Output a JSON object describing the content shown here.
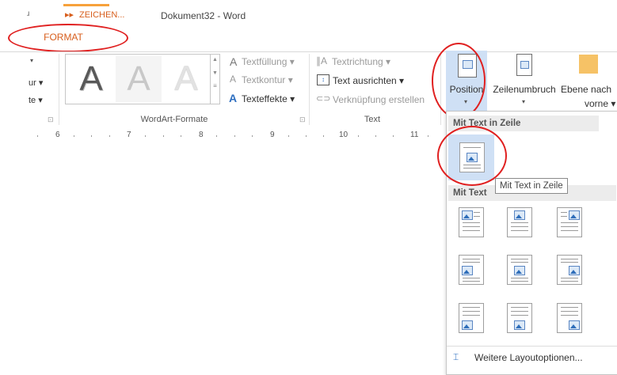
{
  "titlebar": {
    "left_glyph": "ɹ",
    "ctx_tab": "ZEICHEN...",
    "ctx_tab_prefix": "▸▸",
    "doc_title": "Dokument32 - Word",
    "format_tab": "FORMAT"
  },
  "left_partial": {
    "item1": "ur ▾",
    "item2": "te ▾",
    "launcher": "⊡"
  },
  "wordart": {
    "letters": [
      "A",
      "A",
      "A"
    ],
    "group_label": "WordArt-Formate",
    "launcher": "⊡",
    "fill": "Textfüllung ▾",
    "outline": "Textkontur ▾",
    "effects": "Texteffekte ▾"
  },
  "text_group": {
    "direction": "Textrichtung ▾",
    "align": "Text ausrichten ▾",
    "link": "Verknüpfung erstellen",
    "group_label": "Text"
  },
  "arrange": {
    "position": "Position",
    "wrap": "Zeilenumbruch",
    "bring_forward_1": "Ebene nach",
    "bring_forward_2": "vorne ▾",
    "caret": "▾"
  },
  "ruler": {
    "numbers": [
      "6",
      "7",
      "8",
      "9",
      "10",
      "11"
    ]
  },
  "dropdown": {
    "inline_header": "Mit Text in Zeile",
    "wrap_header": "Mit Text",
    "tooltip": "Mit Text in Zeile",
    "more_options": "Weitere Layoutoptionen..."
  },
  "colors": {
    "accent": "#d75d1b",
    "highlight": "#cfe0f5",
    "annotation": "#e02020"
  }
}
